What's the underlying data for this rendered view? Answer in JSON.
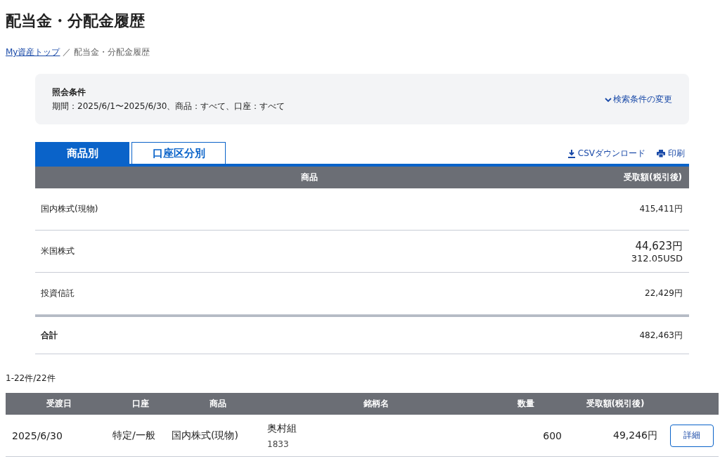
{
  "page_title": "配当金・分配金履歴",
  "breadcrumb": {
    "link": "My資産トップ",
    "separator": "／",
    "current": "配当金・分配金履歴"
  },
  "conditions": {
    "title": "照会条件",
    "text": "期間：2025/6/1〜2025/6/30、商品：すべて、口座：すべて",
    "change_link": "検索条件の変更"
  },
  "tabs": [
    {
      "label": "商品別",
      "selected": true
    },
    {
      "label": "口座区分別",
      "selected": false
    }
  ],
  "actions": {
    "csv": "CSVダウンロード",
    "print": "印刷"
  },
  "summary": {
    "columns": [
      "商品",
      "受取額(税引後)"
    ],
    "rows": [
      {
        "kind": "item",
        "name": "国内株式(現物)",
        "amount": "415,411円"
      },
      {
        "kind": "item",
        "name": "米国株式",
        "amount": "44,623円",
        "sub_amount": "312.05USD"
      },
      {
        "kind": "item",
        "name": "投資信託",
        "amount": "22,429円"
      },
      {
        "kind": "total",
        "name": "合計",
        "amount": "482,463円"
      }
    ]
  },
  "count": "1-22件/22件",
  "detail": {
    "columns": [
      "受渡日",
      "口座",
      "商品",
      "銘柄名",
      "数量",
      "受取額(税引後)"
    ],
    "rows": [
      {
        "date": "2025/6/30",
        "account": "特定/一般",
        "product": "国内株式(現物)",
        "name": "奥村組",
        "code": "1833",
        "quantity": "600",
        "amount": "49,246円",
        "button": "詳細"
      }
    ]
  }
}
